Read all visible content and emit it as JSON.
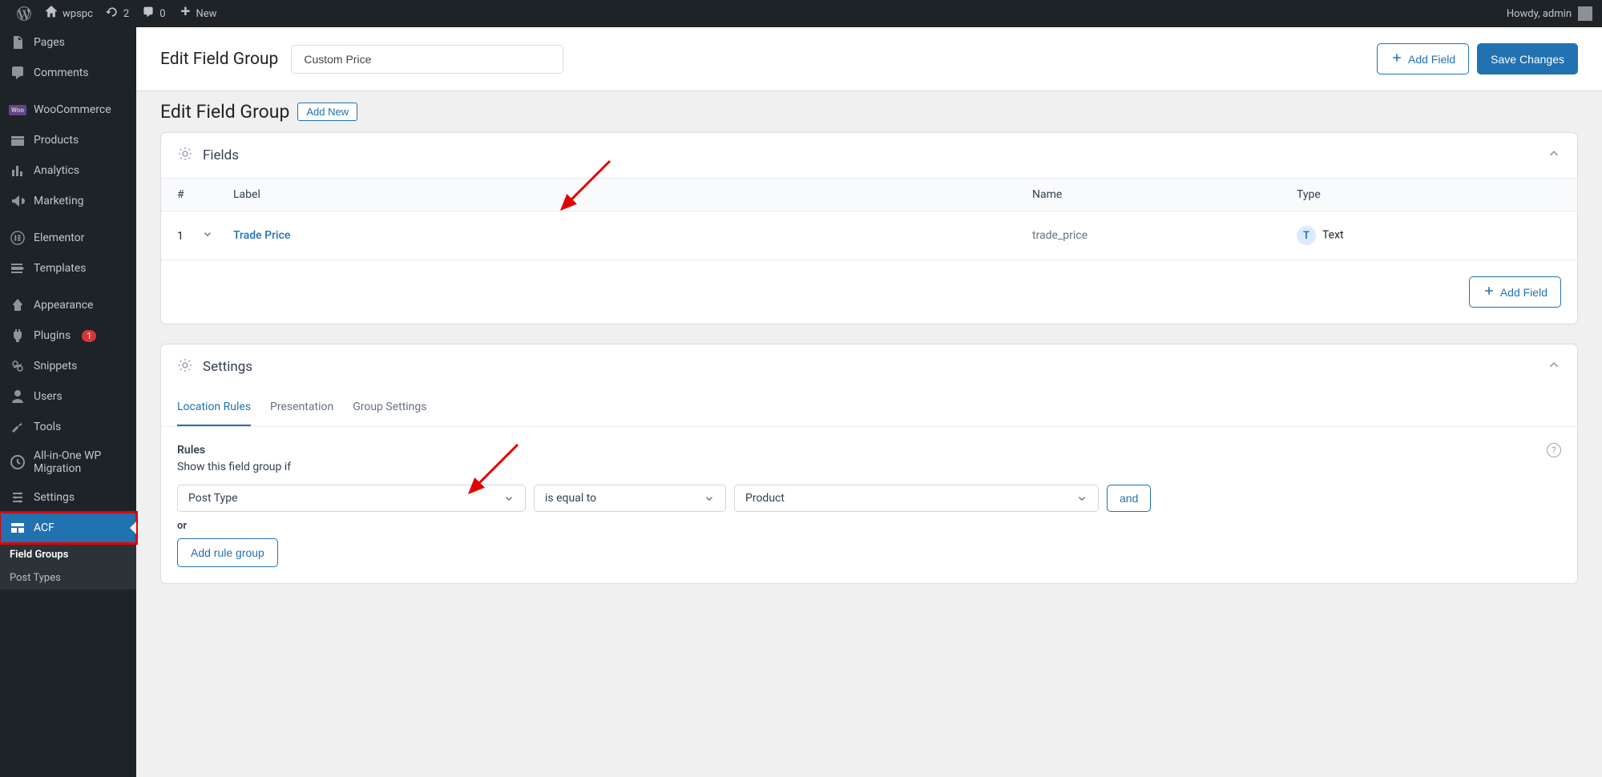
{
  "adminBar": {
    "siteName": "wpspc",
    "updates": "2",
    "comments": "0",
    "new": "New",
    "howdy": "Howdy, admin"
  },
  "sidebar": {
    "pages": "Pages",
    "comments": "Comments",
    "woocommerce": "WooCommerce",
    "products": "Products",
    "analytics": "Analytics",
    "marketing": "Marketing",
    "elementor": "Elementor",
    "templates": "Templates",
    "appearance": "Appearance",
    "plugins": "Plugins",
    "pluginsBadge": "1",
    "snippets": "Snippets",
    "users": "Users",
    "tools": "Tools",
    "migration": "All-in-One WP Migration",
    "settings": "Settings",
    "acf": "ACF",
    "submenu": {
      "fieldGroups": "Field Groups",
      "postTypes": "Post Types"
    }
  },
  "header": {
    "title": "Edit Field Group",
    "groupName": "Custom Price",
    "addField": "Add Field",
    "saveChanges": "Save Changes"
  },
  "legacy": {
    "title": "Edit Field Group",
    "addNew": "Add New"
  },
  "fieldsCard": {
    "title": "Fields",
    "columns": {
      "num": "#",
      "label": "Label",
      "name": "Name",
      "type": "Type"
    },
    "row": {
      "num": "1",
      "label": "Trade Price",
      "name": "trade_price",
      "typeBadge": "T",
      "type": "Text"
    },
    "addField": "Add Field"
  },
  "settingsCard": {
    "title": "Settings",
    "tabs": {
      "location": "Location Rules",
      "presentation": "Presentation",
      "group": "Group Settings"
    },
    "rules": {
      "heading": "Rules",
      "sub": "Show this field group if",
      "postType": "Post Type",
      "operator": "is equal to",
      "value": "Product",
      "and": "and",
      "or": "or",
      "addRuleGroup": "Add rule group"
    }
  }
}
